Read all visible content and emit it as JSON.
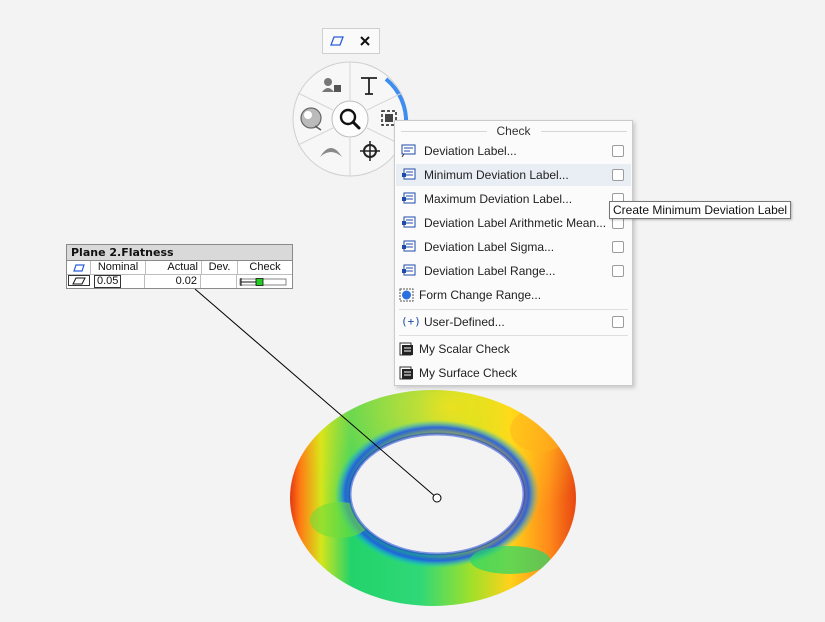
{
  "toolbar": {
    "icons": [
      "parallelogram-icon",
      "close-icon"
    ]
  },
  "radial_menu": {
    "segments": [
      "text-icon",
      "frame-icon",
      "crosshair-icon",
      "arc-icon",
      "palette-icon",
      "user-icon"
    ],
    "center": "magnifier-icon",
    "accent_color": "#3d8ef0"
  },
  "label": {
    "title": "Plane 2.Flatness",
    "headers": {
      "nominal": "Nominal",
      "actual": "Actual",
      "dev": "Dev.",
      "check": "Check"
    },
    "row": {
      "nominal": "0.05",
      "actual": "0.02",
      "dev": "",
      "check_color": "#22cc22"
    }
  },
  "menu": {
    "header": "Check",
    "items": [
      {
        "label": "Deviation Label...",
        "icon": "deviation-label-icon",
        "checkbox": true
      },
      {
        "label": "Minimum Deviation Label...",
        "icon": "deviation-label-icon",
        "checkbox": true
      },
      {
        "label": "Maximum Deviation Label...",
        "icon": "deviation-label-icon",
        "checkbox": true
      },
      {
        "label": "Deviation Label Arithmetic Mean...",
        "icon": "deviation-label-icon",
        "checkbox": true
      },
      {
        "label": "Deviation Label Sigma...",
        "icon": "deviation-label-icon",
        "checkbox": true
      },
      {
        "label": "Deviation Label Range...",
        "icon": "deviation-label-icon",
        "checkbox": true
      },
      {
        "label": "Form Change Range...",
        "icon": "form-change-icon",
        "checkbox": false
      },
      {
        "label": "User-Defined...",
        "icon": "user-defined-icon",
        "checkbox": true
      },
      {
        "label": "My Scalar Check",
        "icon": "script-icon",
        "checkbox": false
      },
      {
        "label": "My Surface Check",
        "icon": "script-icon",
        "checkbox": false
      }
    ]
  },
  "tooltip": "Create Minimum Deviation Label",
  "colormap": [
    "#1a3fd6",
    "#00c8ff",
    "#17d17a",
    "#c8e61e",
    "#ffd21a",
    "#ff7a14",
    "#d4180f"
  ]
}
